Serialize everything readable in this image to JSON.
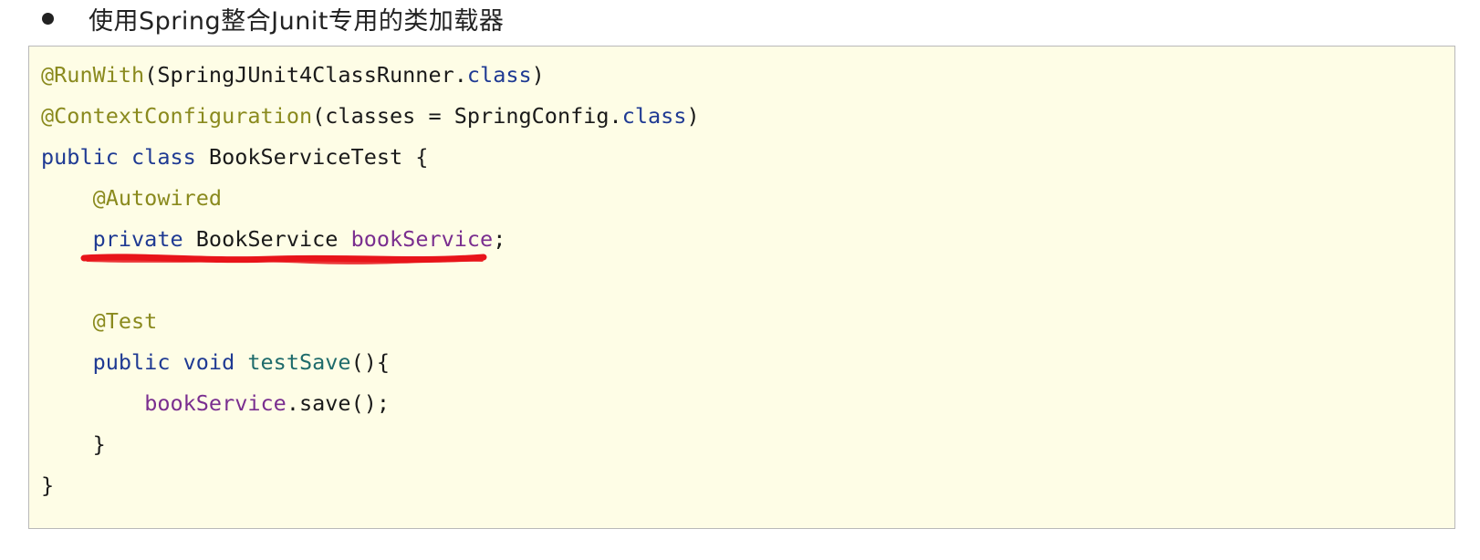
{
  "heading": {
    "text": "使用Spring整合Junit专用的类加载器"
  },
  "code": {
    "lines": [
      [
        {
          "t": "@RunWith",
          "c": "ann"
        },
        {
          "t": "(SpringJUnit4ClassRunner.",
          "c": "plain"
        },
        {
          "t": "class",
          "c": "kw"
        },
        {
          "t": ")",
          "c": "plain"
        }
      ],
      [
        {
          "t": "@ContextConfiguration",
          "c": "ann"
        },
        {
          "t": "(classes = SpringConfig.",
          "c": "plain"
        },
        {
          "t": "class",
          "c": "kw"
        },
        {
          "t": ")",
          "c": "plain"
        }
      ],
      [
        {
          "t": "public class",
          "c": "kw"
        },
        {
          "t": " BookServiceTest {",
          "c": "plain"
        }
      ],
      [
        {
          "t": "    ",
          "c": "plain"
        },
        {
          "t": "@Autowired",
          "c": "ann"
        }
      ],
      [
        {
          "t": "    ",
          "c": "plain"
        },
        {
          "t": "private",
          "c": "kw"
        },
        {
          "t": " BookService ",
          "c": "plain"
        },
        {
          "t": "bookService",
          "c": "fld"
        },
        {
          "t": ";",
          "c": "plain"
        }
      ],
      [
        {
          "t": "",
          "c": "plain"
        }
      ],
      [
        {
          "t": "    ",
          "c": "plain"
        },
        {
          "t": "@Test",
          "c": "ann"
        }
      ],
      [
        {
          "t": "    ",
          "c": "plain"
        },
        {
          "t": "public void",
          "c": "kw"
        },
        {
          "t": " ",
          "c": "plain"
        },
        {
          "t": "testSave",
          "c": "mth"
        },
        {
          "t": "(){",
          "c": "plain"
        }
      ],
      [
        {
          "t": "        ",
          "c": "plain"
        },
        {
          "t": "bookService",
          "c": "fld"
        },
        {
          "t": ".save();",
          "c": "plain"
        }
      ],
      [
        {
          "t": "    }",
          "c": "plain"
        }
      ],
      [
        {
          "t": "}",
          "c": "plain"
        }
      ]
    ]
  },
  "colors": {
    "annotation": "#8a8a1e",
    "keyword": "#1f3a93",
    "field": "#7a2e8f",
    "method": "#1e6b6b",
    "background": "#fefde6",
    "highlight_mark": "#e8141a"
  }
}
